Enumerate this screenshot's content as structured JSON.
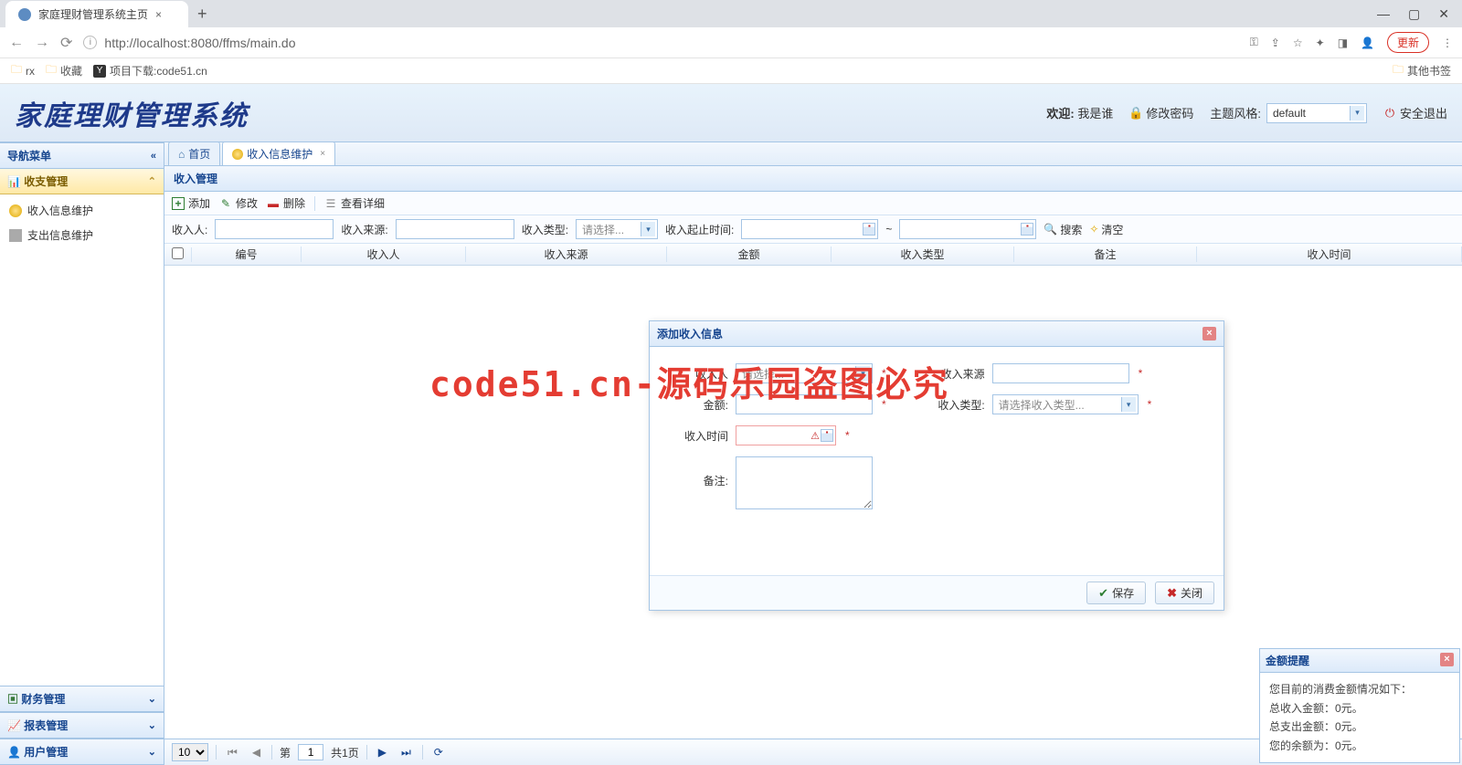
{
  "browser": {
    "tab_title": "家庭理财管理系统主页",
    "url": "http://localhost:8080/ffms/main.do",
    "update": "更新",
    "bookmarks": {
      "rx": "rx",
      "fav": "收藏",
      "proj": "项目下载:code51.cn",
      "other": "其他书签"
    }
  },
  "header": {
    "app_title": "家庭理财管理系统",
    "welcome_label": "欢迎:",
    "welcome_user": "我是谁",
    "change_pwd": "修改密码",
    "theme_label": "主题风格:",
    "theme_value": "default",
    "logout": "安全退出"
  },
  "sidebar": {
    "menu_title": "导航菜单",
    "accordions": {
      "income_expense": "收支管理",
      "finance": "财务管理",
      "report": "报表管理",
      "user": "用户管理"
    },
    "items": {
      "income_info": "收入信息维护",
      "expense_info": "支出信息维护"
    }
  },
  "tabs": {
    "home": "首页",
    "income": "收入信息维护"
  },
  "panel_title": "收入管理",
  "toolbar": {
    "add": "添加",
    "edit": "修改",
    "del": "删除",
    "view": "查看详细"
  },
  "search": {
    "person_label": "收入人:",
    "source_label": "收入来源:",
    "type_label": "收入类型:",
    "type_placeholder": "请选择...",
    "time_label": "收入起止时间:",
    "tilde": "~",
    "search_btn": "搜索",
    "clear_btn": "清空"
  },
  "grid": {
    "cols": {
      "no": "编号",
      "person": "收入人",
      "source": "收入来源",
      "amount": "金额",
      "type": "收入类型",
      "remark": "备注",
      "time": "收入时间"
    }
  },
  "pager": {
    "size": "10",
    "page_prefix": "第",
    "page_value": "1",
    "page_suffix": "共1页"
  },
  "dialog": {
    "title": "添加收入信息",
    "labels": {
      "person": "收入人",
      "source": "收入来源",
      "amount": "金额:",
      "type": "收入类型:",
      "time": "收入时间",
      "remark": "备注:"
    },
    "placeholders": {
      "person_select": "请选择...",
      "type_select": "请选择收入类型..."
    },
    "buttons": {
      "save": "保存",
      "close": "关闭"
    },
    "req": "*"
  },
  "watermark": "code51.cn-源码乐园盗图必究",
  "notif": {
    "title": "金额提醒",
    "line1": "您目前的消费金额情况如下：",
    "line2": "总收入金额：0元。",
    "line3": "总支出金额：0元。",
    "line4": "您的余额为：0元。"
  }
}
